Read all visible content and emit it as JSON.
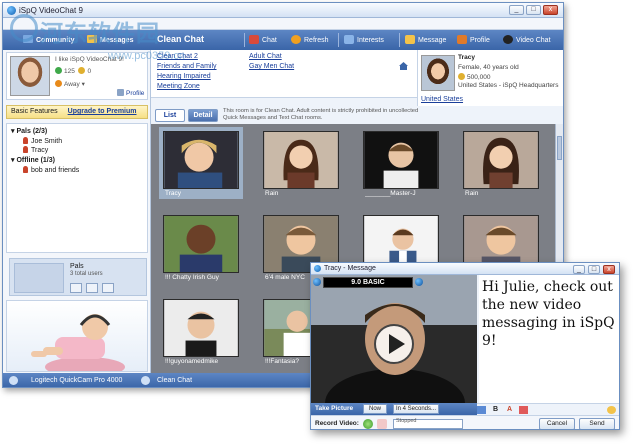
{
  "window": {
    "title": "iSpQ VideoChat 9",
    "buttons": {
      "minimize": "_",
      "maximize": "□",
      "close": "x"
    }
  },
  "watermark": {
    "text": "河东软件园",
    "url": "www.pc0359.cn"
  },
  "left_panel": {
    "tabs": [
      "Community",
      "Messages"
    ],
    "profile": {
      "tagline": "I like iSpQ VideoChat 9!",
      "points": "125",
      "count": "0",
      "status": "Away",
      "profile_button": "Profile"
    },
    "basic_features": "Basic Features",
    "upgrade": "Upgrade to Premium",
    "buddy_tree": {
      "pals_group": "Pals (2/3)",
      "pals": [
        "Joe Smith",
        "Tracy"
      ],
      "offline_group": "Offline (1/3)",
      "offline": [
        "bob and friends"
      ]
    },
    "group_box": {
      "name": "Pals",
      "count": "3 total users"
    }
  },
  "status_bar": {
    "camera": "Logitech QuickCam Pro 4000",
    "room": "Clean Chat"
  },
  "room": {
    "title": "Clean Chat",
    "toolbar": [
      "Chat",
      "Refresh",
      "Interests",
      "Message",
      "Profile",
      "Video Chat"
    ],
    "links_col1": [
      "Clean Chat 2",
      "Friends and Family",
      "Hearing Impaired",
      "Meeting Zone"
    ],
    "links_col2": [
      "Adult Chat",
      "Gay Men Chat"
    ],
    "view_tabs": [
      "List",
      "Detail"
    ],
    "notice": "This room is for Clean Chat. Adult content is strictly prohibited in uncollected Quick Messages and Text Chat rooms."
  },
  "profile_card": {
    "name": "Tracy",
    "details": "Female, 40 years old",
    "points": "500,000",
    "location": "United States - iSpQ Headquarters",
    "link": "United States"
  },
  "users": [
    {
      "name": "Tracy"
    },
    {
      "name": "Rain"
    },
    {
      "name": "_______Master-J"
    },
    {
      "name": "Rain"
    },
    {
      "name": "!!! Chatty Irish Guy"
    },
    {
      "name": "6'4 male NYC"
    },
    {
      "name": ""
    },
    {
      "name": ""
    },
    {
      "name": "!!!guyonamedmike"
    },
    {
      "name": "!!!Fantasia?"
    }
  ],
  "message_window": {
    "title": "Tracy - Message",
    "version_badge": "9.0 BASIC",
    "message": "Hi Julie, check out the new video messaging in iSpQ 9!",
    "take_picture": "Take Picture",
    "now": "Now",
    "in_4_seconds": "In 4 Seconds...",
    "record_video": "Record Video:",
    "record_state": "Stopped",
    "record_progress_pct": 0,
    "cancel": "Cancel",
    "send": "Send",
    "format_icons": [
      "B",
      "A"
    ],
    "title_buttons": {
      "minimize": "_",
      "maximize": "□",
      "close": "x"
    }
  },
  "colors": {
    "accent": "#3a65a8",
    "link": "#1a3f9a",
    "grid_bg": "#7c7f86",
    "close": "#c9442b"
  }
}
